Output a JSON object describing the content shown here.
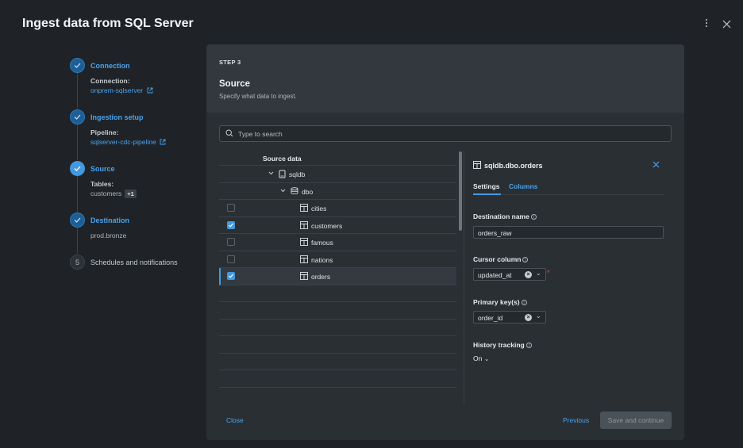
{
  "header": {
    "title": "Ingest data from SQL Server",
    "more_icon": "more-vertical-icon",
    "close_icon": "close-icon"
  },
  "stepper": {
    "steps": [
      {
        "title": "Connection",
        "label": "Connection:",
        "value": "onprem-sqlserver",
        "status": "done"
      },
      {
        "title": "Ingestion setup",
        "label": "Pipeline:",
        "value": "sqlserver-cdc-pipeline",
        "status": "done"
      },
      {
        "title": "Source",
        "label": "Tables:",
        "value": "customers",
        "badge": "+1",
        "status": "active"
      },
      {
        "title": "Destination",
        "value": "prod.bronze",
        "status": "done"
      },
      {
        "title": "Schedules and notifications",
        "number": "5",
        "status": "pending"
      }
    ]
  },
  "panel": {
    "step": "STEP 3",
    "title": "Source",
    "subtitle": "Specify what data to ingest.",
    "search_placeholder": "Type to search"
  },
  "tree": {
    "header": "Source data",
    "catalog": "sqldb",
    "schema": "dbo",
    "tables": [
      {
        "name": "cities",
        "checked": false
      },
      {
        "name": "customers",
        "checked": true
      },
      {
        "name": "famous",
        "checked": false
      },
      {
        "name": "nations",
        "checked": false
      },
      {
        "name": "orders",
        "checked": true,
        "selected": true
      }
    ]
  },
  "detail": {
    "title": "sqldb.dbo.orders",
    "tabs": [
      "Settings",
      "Columns"
    ],
    "destination_name_label": "Destination name",
    "destination_name_value": "orders_raw",
    "cursor_column_label": "Cursor column",
    "cursor_column_value": "updated_at",
    "primary_keys_label": "Primary key(s)",
    "primary_keys_value": "order_id",
    "history_tracking_label": "History tracking",
    "history_tracking_value": "On"
  },
  "footer": {
    "close": "Close",
    "previous": "Previous",
    "save": "Save and continue"
  },
  "colors": {
    "accent": "#4299e1",
    "link": "#4aa3ef",
    "background": "#1f2327",
    "panel": "#2a2f34"
  }
}
